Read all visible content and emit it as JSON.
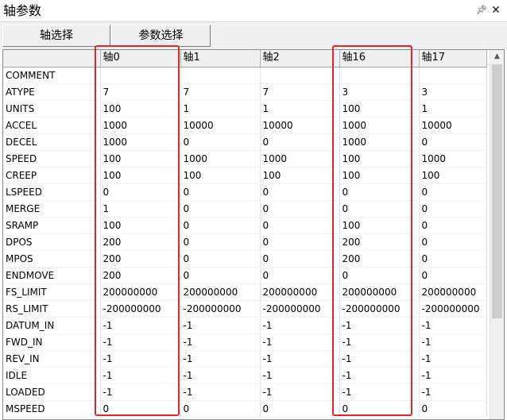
{
  "window": {
    "title": "轴参数",
    "pin_icon": "pin-icon",
    "close_icon": "close-icon"
  },
  "toolbar": {
    "axis_select_label": "轴选择",
    "param_select_label": "参数选择"
  },
  "grid": {
    "columns": [
      "",
      "轴0",
      "轴1",
      "轴2",
      "轴16",
      "轴17"
    ],
    "rows": [
      {
        "name": "COMMENT",
        "values": [
          "",
          "",
          "",
          "",
          ""
        ]
      },
      {
        "name": "ATYPE",
        "values": [
          "7",
          "7",
          "7",
          "3",
          "3"
        ]
      },
      {
        "name": "UNITS",
        "values": [
          "100",
          "1",
          "1",
          "100",
          "1"
        ]
      },
      {
        "name": "ACCEL",
        "values": [
          "1000",
          "10000",
          "10000",
          "1000",
          "10000"
        ]
      },
      {
        "name": "DECEL",
        "values": [
          "1000",
          "0",
          "0",
          "1000",
          "0"
        ]
      },
      {
        "name": "SPEED",
        "values": [
          "100",
          "1000",
          "1000",
          "100",
          "1000"
        ]
      },
      {
        "name": "CREEP",
        "values": [
          "100",
          "100",
          "100",
          "100",
          "100"
        ]
      },
      {
        "name": "LSPEED",
        "values": [
          "0",
          "0",
          "0",
          "0",
          "0"
        ]
      },
      {
        "name": "MERGE",
        "values": [
          "1",
          "0",
          "0",
          "0",
          "0"
        ]
      },
      {
        "name": "SRAMP",
        "values": [
          "100",
          "0",
          "0",
          "100",
          "0"
        ]
      },
      {
        "name": "DPOS",
        "values": [
          "200",
          "0",
          "0",
          "200",
          "0"
        ]
      },
      {
        "name": "MPOS",
        "values": [
          "200",
          "0",
          "0",
          "200",
          "0"
        ]
      },
      {
        "name": "ENDMOVE",
        "values": [
          "200",
          "0",
          "0",
          "0",
          "0"
        ]
      },
      {
        "name": "FS_LIMIT",
        "values": [
          "200000000",
          "200000000",
          "200000000",
          "200000000",
          "200000000"
        ]
      },
      {
        "name": "RS_LIMIT",
        "values": [
          "-200000000",
          "-200000000",
          "-200000000",
          "-200000000",
          "-200000000"
        ]
      },
      {
        "name": "DATUM_IN",
        "values": [
          "-1",
          "-1",
          "-1",
          "-1",
          "-1"
        ]
      },
      {
        "name": "FWD_IN",
        "values": [
          "-1",
          "-1",
          "-1",
          "-1",
          "-1"
        ]
      },
      {
        "name": "REV_IN",
        "values": [
          "-1",
          "-1",
          "-1",
          "-1",
          "-1"
        ]
      },
      {
        "name": "IDLE",
        "values": [
          "-1",
          "-1",
          "-1",
          "-1",
          "-1"
        ]
      },
      {
        "name": "LOADED",
        "values": [
          "-1",
          "-1",
          "-1",
          "-1",
          "-1"
        ]
      },
      {
        "name": "MSPEED",
        "values": [
          "0",
          "0",
          "0",
          "0",
          "0"
        ]
      }
    ]
  },
  "scrollbar": {
    "up_icon": "chevron-up-icon"
  },
  "colors": {
    "highlight": "#e8262a",
    "header_bg": "#f0f0f0"
  }
}
